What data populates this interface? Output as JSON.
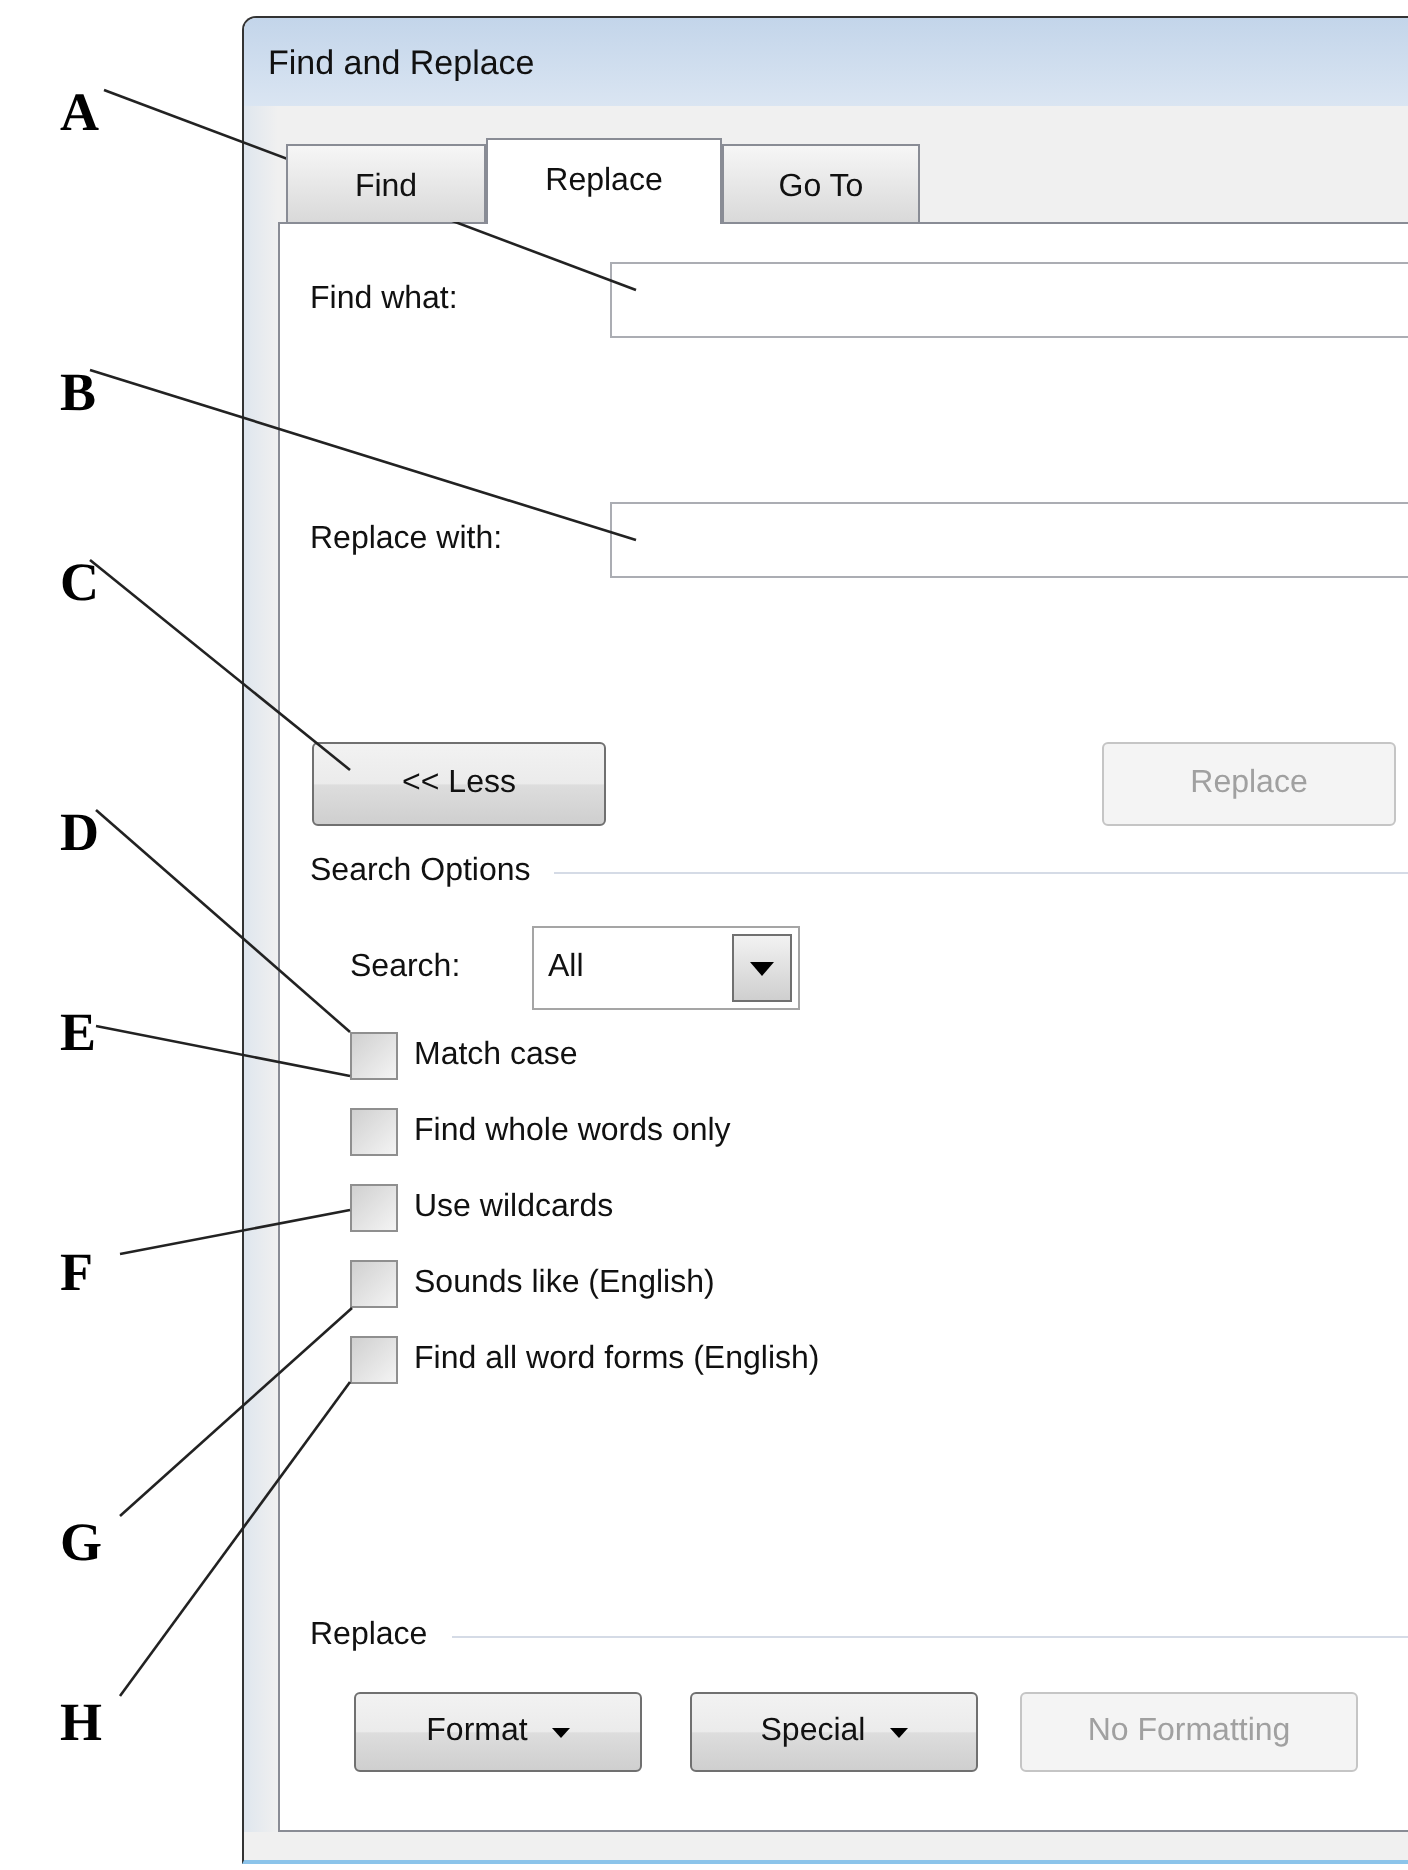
{
  "dialog": {
    "title": "Find and Replace",
    "tabs": [
      {
        "label": "Find",
        "selected": false
      },
      {
        "label": "Replace",
        "selected": true
      },
      {
        "label": "Go To",
        "selected": false
      }
    ],
    "fields": [
      {
        "label": "Find what:"
      },
      {
        "label": "Replace with:"
      }
    ],
    "less_button": "<< Less",
    "replace_button": {
      "label": "Replace",
      "disabled": true
    },
    "search_options": {
      "title": "Search Options",
      "search_label": "Search:",
      "search_value": "All",
      "checkboxes": [
        {
          "label": "Match case",
          "checked": false
        },
        {
          "label": "Find whole words only",
          "checked": false
        },
        {
          "label": "Use wildcards",
          "checked": false
        },
        {
          "label": "Sounds like (English)",
          "checked": false
        },
        {
          "label": "Find all word forms (English)",
          "checked": false
        }
      ]
    },
    "replace_section": {
      "title": "Replace",
      "buttons": [
        {
          "label": "Format",
          "dropdown": true,
          "disabled": false
        },
        {
          "label": "Special",
          "dropdown": true,
          "disabled": false
        },
        {
          "label": "No Formatting",
          "dropdown": false,
          "disabled": true
        }
      ]
    }
  },
  "callouts": [
    {
      "letter": "A"
    },
    {
      "letter": "B"
    },
    {
      "letter": "C"
    },
    {
      "letter": "D"
    },
    {
      "letter": "E"
    },
    {
      "letter": "F"
    },
    {
      "letter": "G"
    },
    {
      "letter": "H"
    }
  ]
}
